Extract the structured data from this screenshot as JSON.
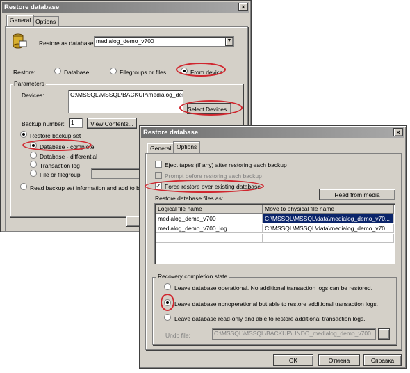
{
  "back_dialog": {
    "title": "Restore database",
    "tabs": [
      "General",
      "Options"
    ],
    "restore_as_label": "Restore as database:",
    "restore_as_value": "medialog_demo_v700",
    "restore_label": "Restore:",
    "restore_options": [
      "Database",
      "Filegroups or files",
      "From device"
    ],
    "parameters_label": "Parameters",
    "devices_label": "Devices:",
    "devices_value": "C:\\MSSQL\\MSSQL\\BACKUP\\medialog_demo",
    "select_devices_label": "Select Devices...",
    "backup_number_label": "Backup number:",
    "backup_number_value": "1",
    "view_contents_label": "View Contents...",
    "restore_backup_set_label": "Restore backup set",
    "backup_types": [
      "Database - complete",
      "Database - differential",
      "Transaction log",
      "File or filegroup"
    ],
    "read_backup_label": "Read backup set information and add to backup"
  },
  "front_dialog": {
    "title": "Restore database",
    "tabs": [
      "General",
      "Options"
    ],
    "checks": [
      {
        "label": "Eject tapes (if any) after restoring each backup",
        "checked": false,
        "disabled": false
      },
      {
        "label": "Prompt before restoring each backup",
        "checked": false,
        "disabled": true
      },
      {
        "label": "Force restore over existing database",
        "checked": true,
        "disabled": false
      }
    ],
    "restore_files_label": "Restore database files as:",
    "read_from_media_label": "Read from media",
    "grid_headers": [
      "Logical file name",
      "Move to physical file name"
    ],
    "grid_rows": [
      {
        "logical": "medialog_demo_v700",
        "physical": "C:\\MSSQL\\MSSQL\\data\\medialog_demo_v70..."
      },
      {
        "logical": "medialog_demo_v700_log",
        "physical": "C:\\MSSQL\\MSSQL\\data\\medialog_demo_v70..."
      }
    ],
    "recovery_label": "Recovery completion state",
    "recovery_options": [
      "Leave database operational. No additional transaction logs can be restored.",
      "Leave database nonoperational but able to restore additional transaction logs.",
      "Leave database read-only and able to restore additional transaction logs."
    ],
    "undo_label": "Undo file:",
    "undo_value": "C:\\MSSQL\\MSSQL\\BACKUP\\UNDO_medialog_demo_v700.",
    "browse_label": "...",
    "ok_label": "OK",
    "cancel_label": "Отмена",
    "help_label": "Справка"
  },
  "colors": {
    "annotation_red": "#d0262e",
    "dialog_face": "#d4d0c8",
    "selection": "#0a246a"
  }
}
